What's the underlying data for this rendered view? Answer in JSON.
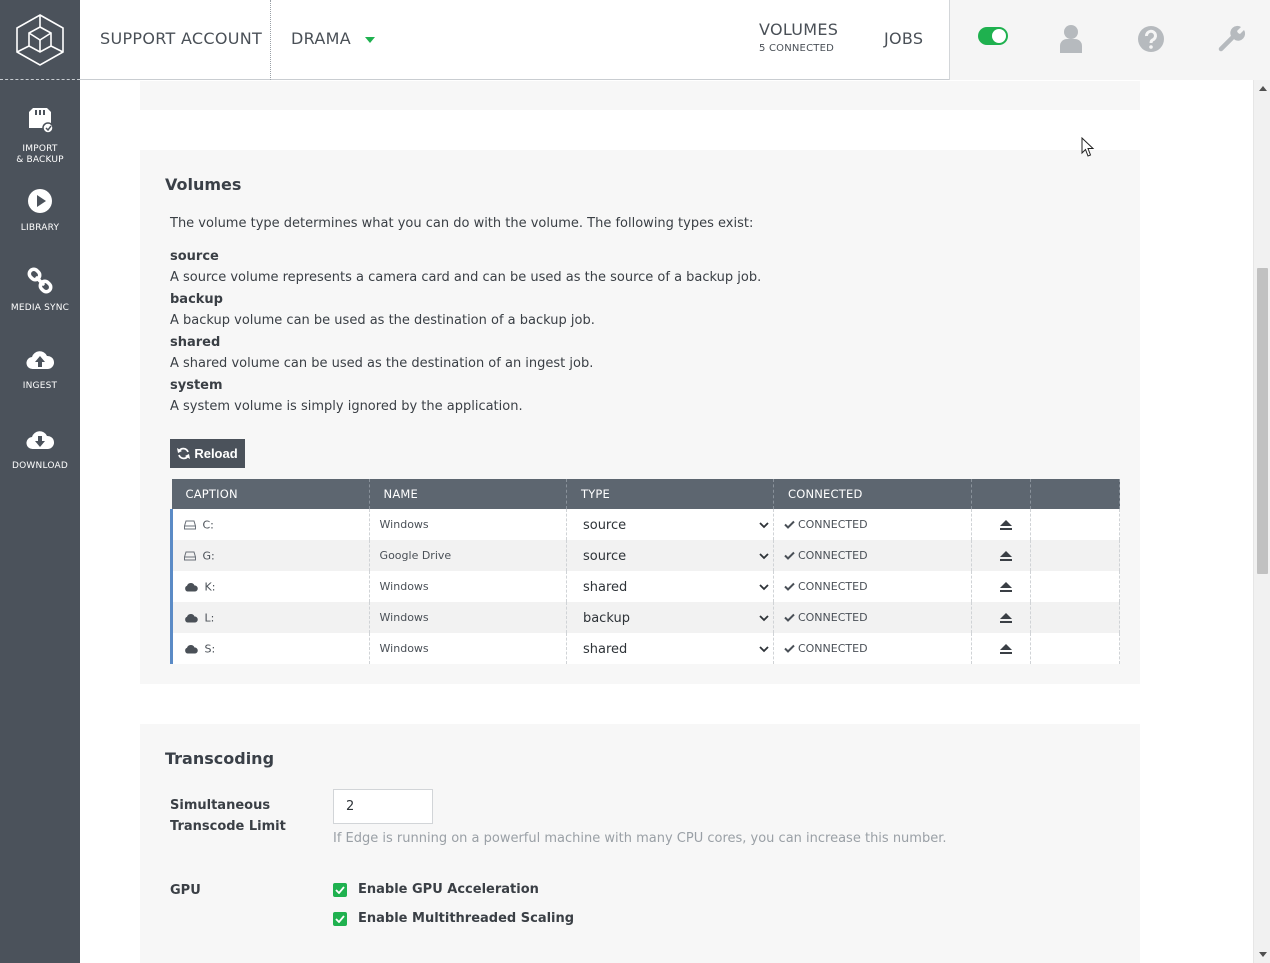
{
  "sidebar": {
    "items": [
      {
        "label_line1": "IMPORT",
        "label_line2": "& BACKUP",
        "icon": "sd-card-icon"
      },
      {
        "label_line1": "LIBRARY",
        "label_line2": "",
        "icon": "play-icon"
      },
      {
        "label_line1": "MEDIA SYNC",
        "label_line2": "",
        "icon": "link-icon"
      },
      {
        "label_line1": "INGEST",
        "label_line2": "",
        "icon": "cloud-upload-icon"
      },
      {
        "label_line1": "DOWNLOAD",
        "label_line2": "",
        "icon": "cloud-download-icon"
      }
    ]
  },
  "topbar": {
    "account": "SUPPORT ACCOUNT",
    "project": "DRAMA",
    "volumes_label": "VOLUMES",
    "volumes_status": "5 CONNECTED",
    "jobs_label": "JOBS"
  },
  "volumes": {
    "heading": "Volumes",
    "intro": "The volume type determines what you can do with the volume. The following types exist:",
    "types": [
      {
        "name": "source",
        "description": "A source volume represents a camera card and can be used as the source of a backup job."
      },
      {
        "name": "backup",
        "description": "A backup volume can be used as the destination of a backup job."
      },
      {
        "name": "shared",
        "description": "A shared volume can be used as the destination of an ingest job."
      },
      {
        "name": "system",
        "description": "A system volume is simply ignored by the application."
      }
    ],
    "reload_label": "Reload",
    "columns": [
      "CAPTION",
      "NAME",
      "TYPE",
      "CONNECTED",
      "",
      ""
    ],
    "rows": [
      {
        "caption": "C:",
        "icon": "drive-icon",
        "name": "Windows",
        "type": "source",
        "connected": "CONNECTED"
      },
      {
        "caption": "G:",
        "icon": "drive-icon",
        "name": "Google Drive",
        "type": "source",
        "connected": "CONNECTED"
      },
      {
        "caption": "K:",
        "icon": "cloud-icon",
        "name": "Windows",
        "type": "shared",
        "connected": "CONNECTED"
      },
      {
        "caption": "L:",
        "icon": "cloud-icon",
        "name": "Windows",
        "type": "backup",
        "connected": "CONNECTED"
      },
      {
        "caption": "S:",
        "icon": "cloud-icon",
        "name": "Windows",
        "type": "shared",
        "connected": "CONNECTED"
      }
    ]
  },
  "transcoding": {
    "heading": "Transcoding",
    "limit_label_line1": "Simultaneous",
    "limit_label_line2": "Transcode Limit",
    "limit_value": "2",
    "limit_help": "If Edge is running on a powerful machine with many CPU cores, you can increase this number.",
    "gpu_label": "GPU",
    "gpu_options": [
      {
        "label": "Enable GPU Acceleration",
        "checked": true
      },
      {
        "label": "Enable Multithreaded Scaling",
        "checked": true
      }
    ]
  },
  "colors": {
    "sidebar": "#4b525b",
    "accent_green": "#1fb14f",
    "table_header": "#5d6670",
    "row_marker": "#5b8bc6"
  }
}
